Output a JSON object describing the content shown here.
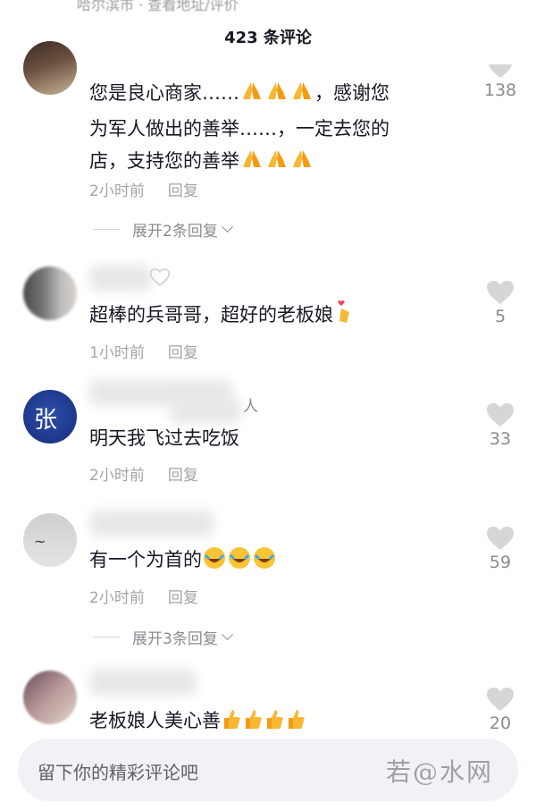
{
  "top_cut_text": "哈尔滨市 · 查看地址/评价",
  "header": {
    "title": "423 条评论"
  },
  "comments": [
    {
      "username": "",
      "text": "您是良心商家……🙏🙏🙏，感谢您为军人做出的善举……，一定去您的店，支持您的善举🙏🙏🙏",
      "text_lines": [
        "您是良心商家……",
        "为军人做出的善举……，一定去您的",
        "店，支持您的善举"
      ],
      "time": "2小时前",
      "reply_label": "回复",
      "expand_label": "展开2条回复",
      "likes": "138"
    },
    {
      "username": "",
      "text": "超棒的兵哥哥，超好的老板娘",
      "time": "1小时前",
      "reply_label": "回复",
      "likes": "5"
    },
    {
      "username": "人",
      "text": "明天我飞过去吃饭",
      "time": "2小时前",
      "reply_label": "回复",
      "likes": "33"
    },
    {
      "username": "",
      "text": "有一个为首的",
      "time": "2小时前",
      "reply_label": "回复",
      "expand_label": "展开3条回复",
      "likes": "59"
    },
    {
      "username": "",
      "text": "老板娘人美心善",
      "likes": "20"
    }
  ],
  "input": {
    "placeholder": "留下你的精彩评论吧"
  },
  "watermark": {
    "text": "若@水网"
  },
  "icons": {
    "like": "heart-icon",
    "expand": "chevron-down-icon",
    "pray": "pray-emoji",
    "finger_heart": "finger-heart-emoji",
    "laugh": "laugh-cry-emoji",
    "thumbs": "thumbs-up-emoji"
  },
  "colors": {
    "primary_text": "#161823",
    "secondary_text": "#8a8b91",
    "heart": "#d6d6d9",
    "input_bg": "#f1f2f5"
  }
}
